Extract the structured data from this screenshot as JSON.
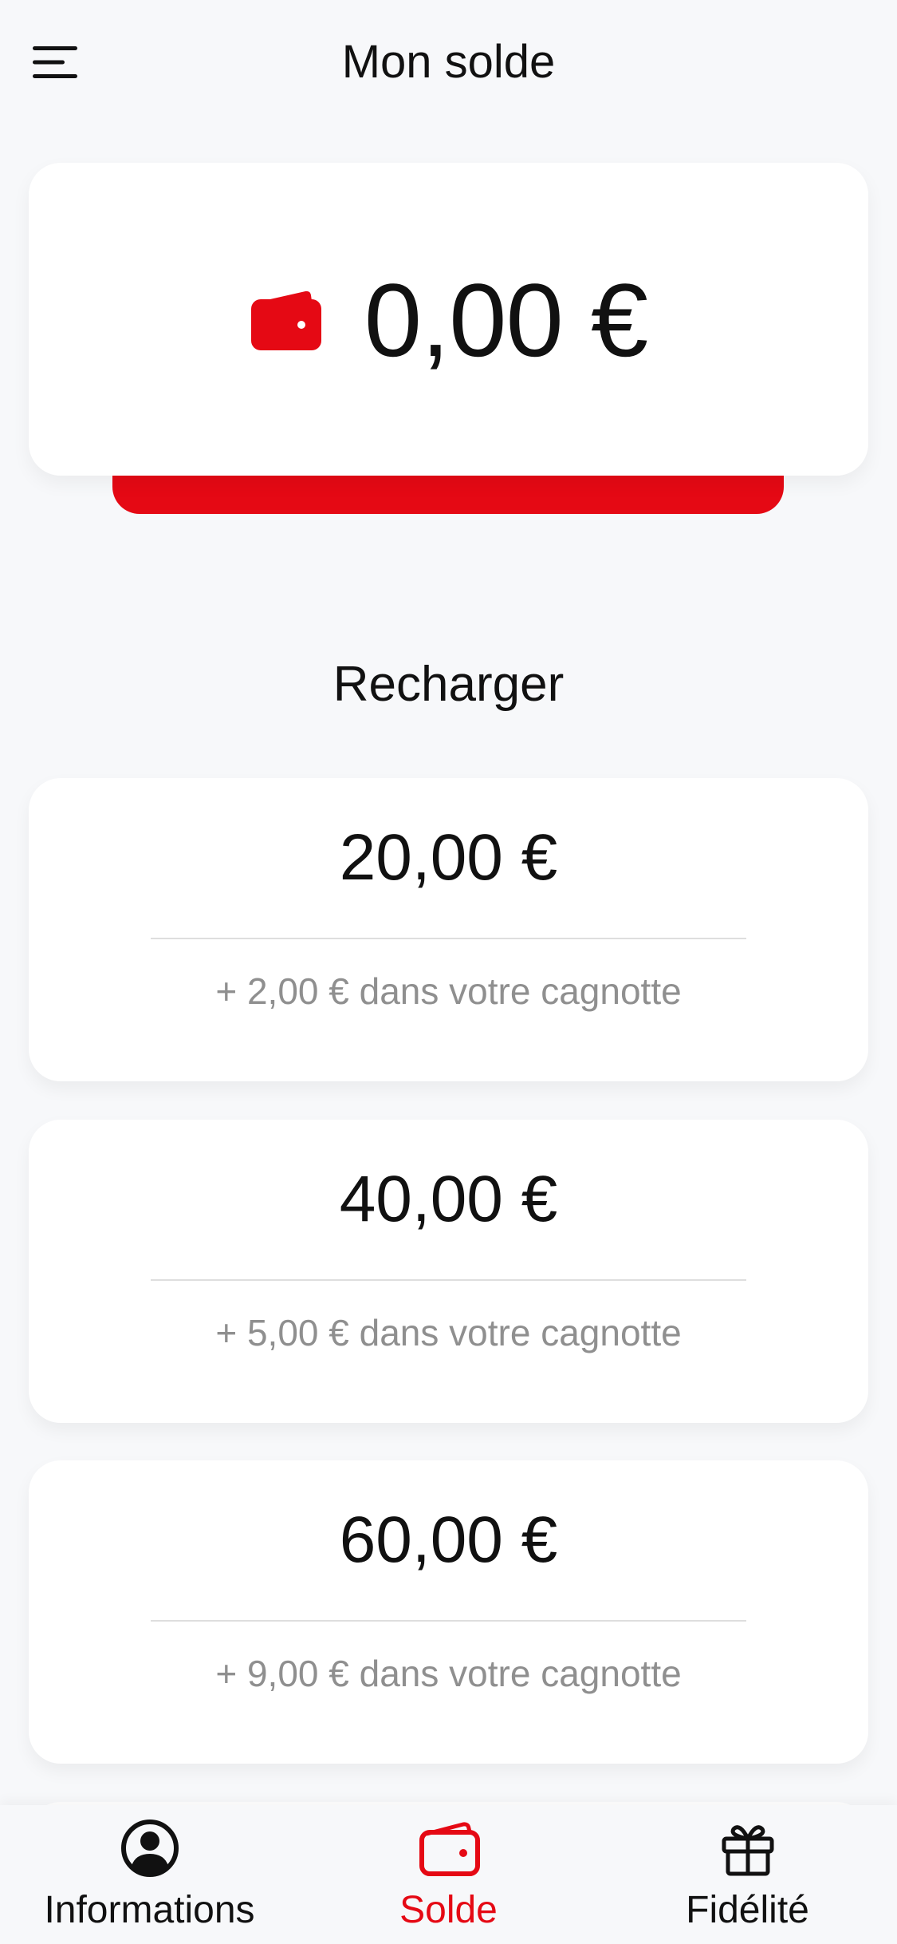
{
  "header": {
    "title": "Mon solde",
    "menu_icon": "menu-icon"
  },
  "balance": {
    "amount": "0,00 €",
    "icon": "wallet-icon"
  },
  "recharge": {
    "title": "Recharger",
    "options": [
      {
        "amount": "20,00 €",
        "bonus": "+ 2,00 € dans votre cagnotte"
      },
      {
        "amount": "40,00 €",
        "bonus": "+ 5,00 € dans votre cagnotte"
      },
      {
        "amount": "60,00 €",
        "bonus": "+ 9,00 € dans votre cagnotte"
      }
    ]
  },
  "bottom_nav": {
    "items": [
      {
        "label": "Informations",
        "icon": "user-circle-icon",
        "active": false
      },
      {
        "label": "Solde",
        "icon": "wallet-icon",
        "active": true
      },
      {
        "label": "Fidélité",
        "icon": "gift-icon",
        "active": false
      }
    ]
  },
  "colors": {
    "accent": "#e50914",
    "background": "#f7f8fa",
    "card": "#ffffff",
    "muted_text": "#8f8f8f"
  }
}
